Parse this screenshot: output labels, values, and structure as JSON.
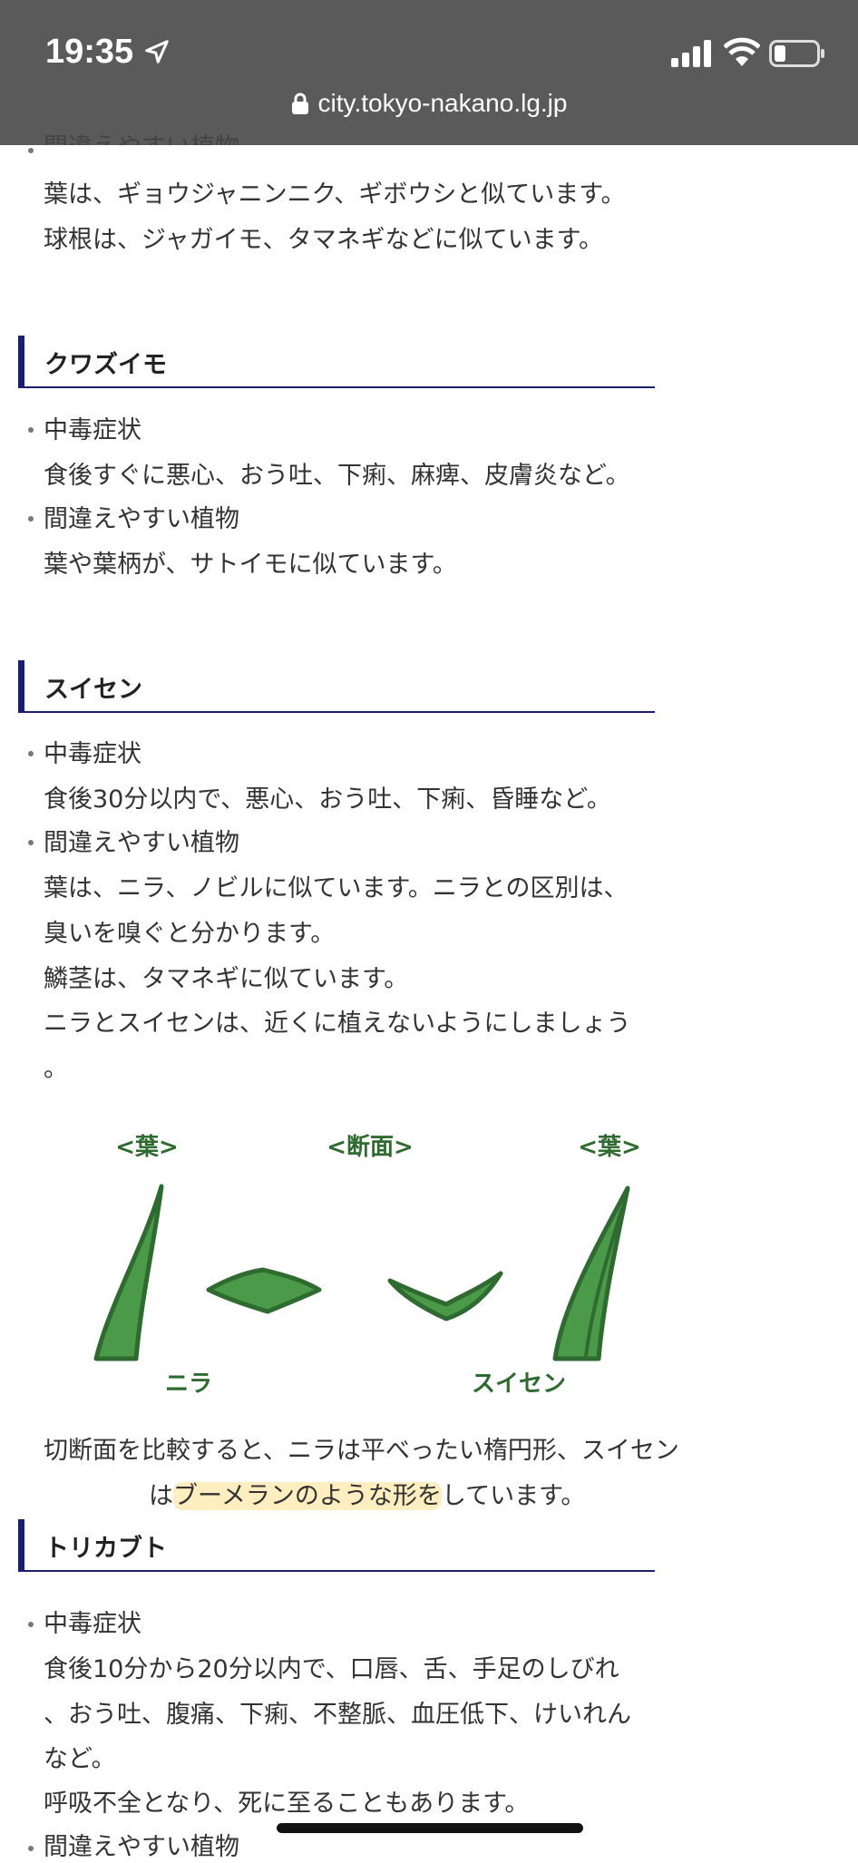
{
  "status_bar": {
    "time": "19:35",
    "url": "city.tokyo-nakano.lg.jp"
  },
  "sections": {
    "top": {
      "cut_label": "間違えやすい植物",
      "lines": [
        "葉は、ギョウジャニンニク、ギボウシと似ています。",
        "球根は、ジャガイモ、タマネギなどに似ています。"
      ]
    },
    "kuwazuimo": {
      "title": "クワズイモ",
      "sym_label": "中毒症状",
      "sym_text": "食後すぐに悪心、おう吐、下痢、麻痺、皮膚炎など。",
      "conf_label": "間違えやすい植物",
      "conf_text": "葉や葉柄が、サトイモに似ています。"
    },
    "suisen": {
      "title": "スイセン",
      "sym_label": "中毒症状",
      "sym_text": "食後30分以内で、悪心、おう吐、下痢、昏睡など。",
      "conf_label": "間違えやすい植物",
      "conf_lines": [
        "葉は、ニラ、ノビルに似ています。ニラとの区別は、",
        "臭いを嗅ぐと分かります。",
        "鱗茎は、タマネギに似ています。",
        "ニラとスイセンは、近くに植えないようにしましょう",
        "。"
      ],
      "figure": {
        "label_leaf_left": "<葉>",
        "label_section": "<断面>",
        "label_leaf_right": "<葉>",
        "label_nira": "ニラ",
        "label_suisen": "スイセン",
        "green": "#4a9a4a",
        "outline": "#2f6a30"
      },
      "caption_line1": "切断面を比較すると、ニラは平べったい楕円形、スイセン",
      "caption_prefix": "は",
      "caption_highlight": "ブーメランのような形を",
      "caption_suffix": "しています。"
    },
    "torikabuto": {
      "title": "トリカブト",
      "sym_label": "中毒症状",
      "sym_lines": [
        "食後10分から20分以内で、口唇、舌、手足のしびれ",
        "、おう吐、腹痛、下痢、不整脈、血圧低下、けいれん",
        "など。",
        "呼吸不全となり、死に至ることもあります。"
      ],
      "conf_label": "間違えやすい植物"
    }
  },
  "colors": {
    "status_bg": "#5a5a5a",
    "heading_rule": "#1b1f6b",
    "highlight": "#ffe18c"
  }
}
